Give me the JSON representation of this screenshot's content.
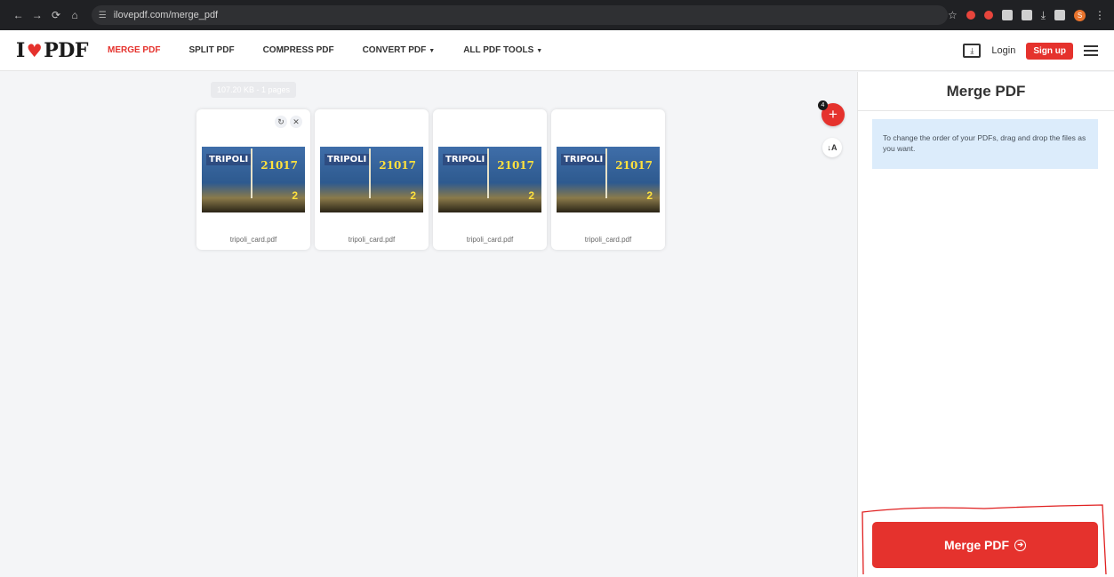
{
  "browser": {
    "back": "←",
    "forward": "→",
    "reload": "⟳",
    "home": "⌂",
    "url": "ilovepdf.com/merge_pdf",
    "profile_initial": "S"
  },
  "header": {
    "logo_left": "I",
    "logo_right": "PDF",
    "menu": [
      {
        "label": "MERGE PDF"
      },
      {
        "label": "SPLIT PDF"
      },
      {
        "label": "COMPRESS PDF"
      },
      {
        "label": "CONVERT PDF"
      },
      {
        "label": "ALL PDF TOOLS"
      }
    ],
    "login": "Login",
    "signup": "Sign up"
  },
  "workspace": {
    "tooltip": "107.20 KB - 1 pages",
    "add_count": "4",
    "files": [
      {
        "name": "tripoli_card.pdf"
      },
      {
        "name": "tripoli_card.pdf"
      },
      {
        "name": "tripoli_card.pdf"
      },
      {
        "name": "tripoli_card.pdf"
      }
    ],
    "thumb": {
      "brand": "TRIPOLI",
      "number": "21017",
      "level": "2"
    }
  },
  "sidebar": {
    "title": "Merge PDF",
    "info": "To change the order of your PDFs, drag and drop the files as you want.",
    "merge_button": "Merge PDF"
  },
  "colors": {
    "brand_red": "#e5322d",
    "info_blue": "#dcecfb"
  }
}
